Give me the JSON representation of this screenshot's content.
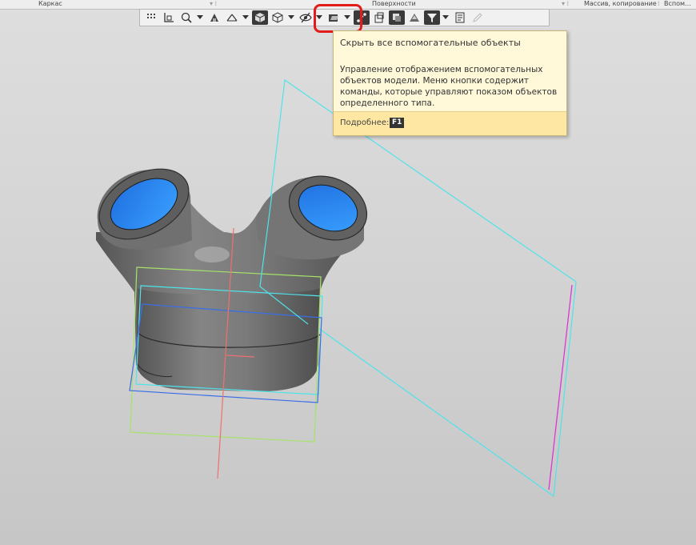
{
  "panel_strip": {
    "left_label": "Каркас",
    "center_label": "Поверхности",
    "right_label_1": "Массив, копирование",
    "right_label_2": "Вспом..."
  },
  "toolbar": {
    "buttons": [
      "grid-icon",
      "local-cs-icon",
      "zoom-icon",
      "zoom-dropdown",
      "orient-icon",
      "perspective-icon",
      "view-dropdown",
      "shaded-icon",
      "wireframe-icon",
      "display-dropdown",
      "hide-aux-objects-icon",
      "hide-aux-dropdown",
      "section-icon",
      "section-dropdown",
      "edges-icon",
      "fix-icon",
      "layers-icon",
      "styles-icon",
      "filter-icon",
      "filter-dropdown",
      "properties-icon",
      "pencil-icon"
    ]
  },
  "tooltip": {
    "title": "Скрыть все вспомогательные объекты",
    "description": "Управление отображением вспомогательных объектов модели. Меню кнопки содержит команды, которые управляют показом объектов определенного типа.",
    "more_label": "Подробнее:",
    "hotkey": "F1"
  },
  "colors": {
    "highlight": "#e21b1b",
    "tooltip_bg": "#fff9d9",
    "tooltip_footer": "#fde7a3",
    "plane_cyan": "#4fe3ea",
    "plane_green": "#a6e36a",
    "plane_blue": "#3a6ee8",
    "axis_red": "#f07070",
    "axis_magenta": "#d43ad4",
    "part_grey": "#6f6f6f",
    "bore_blue": "#2a8bf0"
  }
}
